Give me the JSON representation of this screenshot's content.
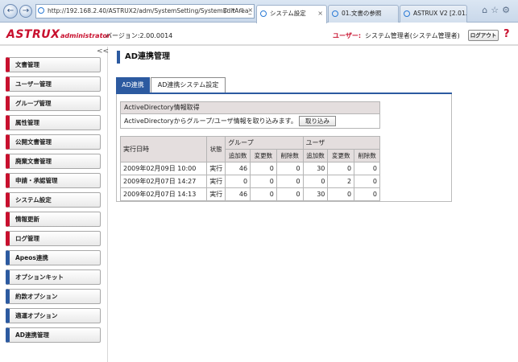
{
  "browser": {
    "address": "http://192.168.2.40/ASTRUX2/adm/SystemSetting/SystemEditArea_",
    "address_tools": "ρ ▾ ⊂ ×",
    "tabs": [
      {
        "label": "システム設定",
        "active": true
      },
      {
        "label": "01.文書の参照",
        "active": false
      },
      {
        "label": "ASTRUX V2 [2.01.0...",
        "active": false
      }
    ]
  },
  "header": {
    "logo": "ASTRUX",
    "logo_sub": "administrator",
    "version": "バージョン:2.00.0014",
    "user_label": "ユーザー:",
    "user_name": "システム管理者(システム管理者)",
    "logout": "ログアウト",
    "help": "?"
  },
  "sidebar": {
    "collapse": "<<",
    "items": [
      {
        "label": "文書管理",
        "color": "red"
      },
      {
        "label": "ユーザー管理",
        "color": "red"
      },
      {
        "label": "グループ管理",
        "color": "red"
      },
      {
        "label": "属性管理",
        "color": "red"
      },
      {
        "label": "公開文書管理",
        "color": "red"
      },
      {
        "label": "廃棄文書管理",
        "color": "red"
      },
      {
        "label": "申請・承認管理",
        "color": "red"
      },
      {
        "label": "システム設定",
        "color": "red"
      },
      {
        "label": "情報更新",
        "color": "red"
      },
      {
        "label": "ログ管理",
        "color": "red"
      },
      {
        "label": "Apeos連携",
        "color": "blue"
      },
      {
        "label": "オプションキット",
        "color": "blue"
      },
      {
        "label": "約款オプション",
        "color": "blue"
      },
      {
        "label": "適運オプション",
        "color": "blue"
      },
      {
        "label": "AD連携管理",
        "color": "blue"
      }
    ]
  },
  "main": {
    "title": "AD連携管理",
    "tabs": [
      {
        "label": "AD連携",
        "active": true
      },
      {
        "label": "AD連携システム設定",
        "active": false
      }
    ],
    "info": {
      "header": "ActiveDirectory情報取得",
      "text": "ActiveDirectoryからグループ/ユーザ情報を取り込みます。",
      "button": "取り込み"
    },
    "history": {
      "col_datetime": "実行日時",
      "col_status": "状態",
      "group_label": "グループ",
      "user_label": "ユーザ",
      "sub_add": "追加数",
      "sub_change": "変更数",
      "sub_delete": "削除数",
      "rows": [
        {
          "datetime": "2009年02月09日 10:00",
          "status": "実行",
          "g_add": "46",
          "g_change": "0",
          "g_delete": "0",
          "u_add": "30",
          "u_change": "0",
          "u_delete": "0"
        },
        {
          "datetime": "2009年02月07日 14:27",
          "status": "実行",
          "g_add": "0",
          "g_change": "0",
          "g_delete": "0",
          "u_add": "0",
          "u_change": "2",
          "u_delete": "0"
        },
        {
          "datetime": "2009年02月07日 14:13",
          "status": "実行",
          "g_add": "46",
          "g_change": "0",
          "g_delete": "0",
          "u_add": "30",
          "u_change": "0",
          "u_delete": "0"
        }
      ]
    }
  },
  "colors": {
    "brand_red": "#c8102e",
    "accent_blue": "#2c5aa0"
  }
}
